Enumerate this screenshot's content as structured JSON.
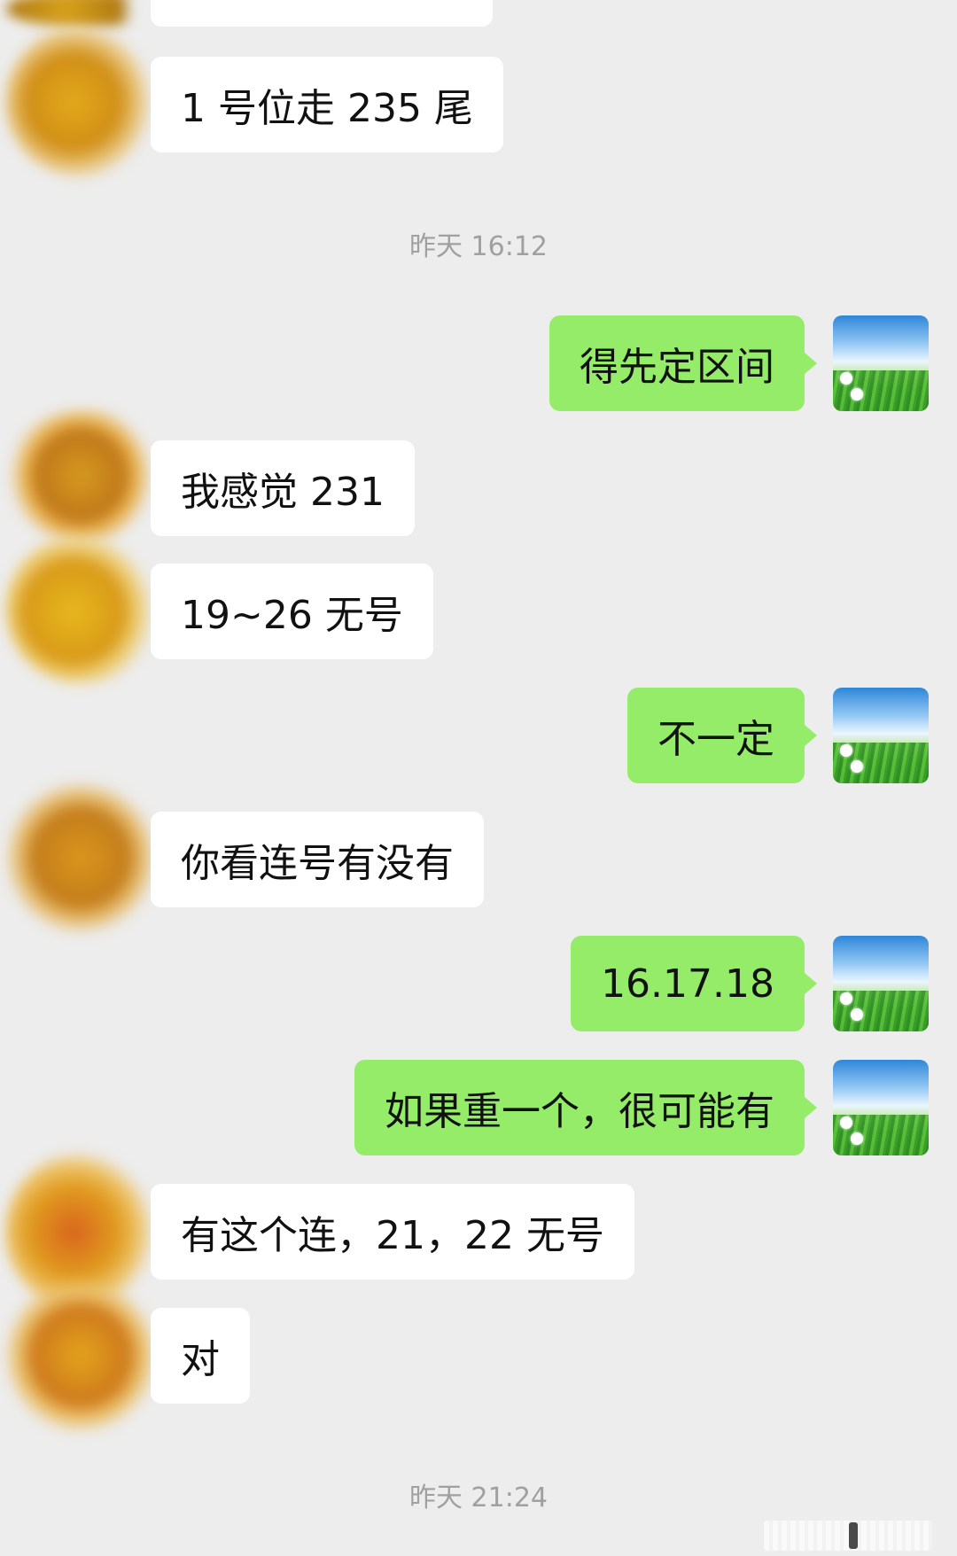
{
  "chat": {
    "partial_top_bubble": "",
    "messages": [
      {
        "side": "in",
        "text": "1 号位走 235 尾"
      },
      {
        "side": "ts",
        "text": "昨天 16:12"
      },
      {
        "side": "out",
        "text": "得先定区间"
      },
      {
        "side": "in",
        "text": "我感觉 231"
      },
      {
        "side": "in",
        "text": "19~26 无号"
      },
      {
        "side": "out",
        "text": "不一定"
      },
      {
        "side": "in",
        "text": "你看连号有没有"
      },
      {
        "side": "out",
        "text": "16.17.18"
      },
      {
        "side": "out",
        "text": "如果重一个，很可能有"
      },
      {
        "side": "in",
        "text": "有这个连，21，22 无号"
      },
      {
        "side": "in",
        "text": "对"
      },
      {
        "side": "ts",
        "text": "昨天 21:24"
      }
    ]
  },
  "colors": {
    "background": "#ededed",
    "incoming_bubble": "#ffffff",
    "outgoing_bubble": "#95ec69",
    "timestamp_text": "#a0a0a0"
  },
  "icons": {
    "contact_avatar": "blurred-avatar-icon",
    "self_avatar": "grass-sky-avatar-icon"
  }
}
